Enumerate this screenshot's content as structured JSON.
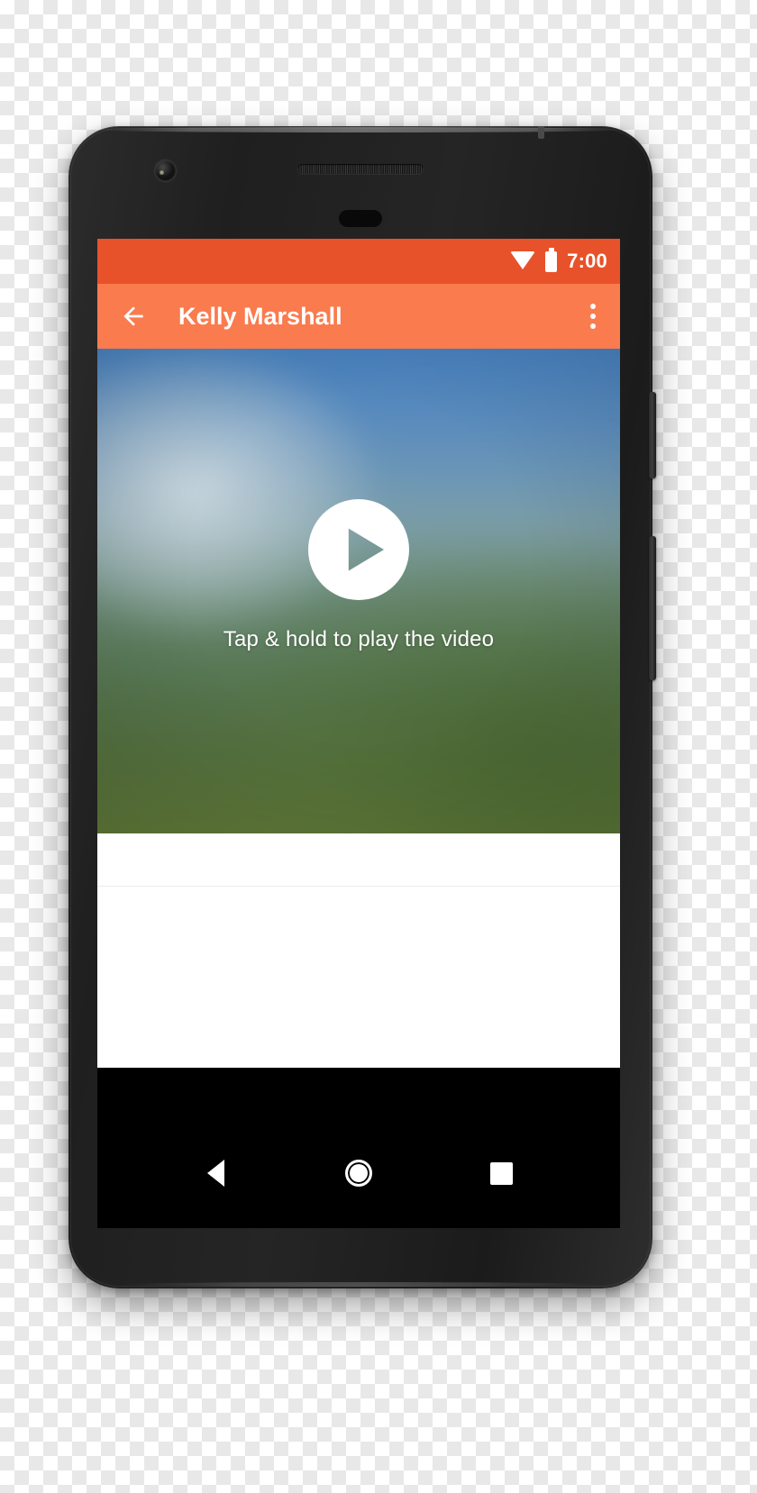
{
  "device": {
    "name": "android-phone-mockup",
    "front_camera_icon": "camera-icon",
    "earpiece_icon": "speaker-grille-icon",
    "sensor_icon": "proximity-sensor-icon",
    "power_button": "power-button",
    "volume_button": "volume-button"
  },
  "status_bar": {
    "background_color": "#E8522A",
    "wifi_icon": "wifi-icon",
    "battery_icon": "battery-full-icon",
    "time": "7:00"
  },
  "app_bar": {
    "background_color": "#FA7B4E",
    "back_icon": "back-arrow-icon",
    "title": "Kelly Marshall",
    "overflow_icon": "more-vert-icon"
  },
  "video": {
    "play_icon": "play-circle-icon",
    "caption": "Tap & hold to play the video",
    "thumbnail_description": "blurred-landscape-sky-and-grass"
  },
  "content": {
    "background_color": "#FFFFFF",
    "divider_color": "#ECECEC"
  },
  "nav_bar": {
    "background_color": "#000000",
    "back_icon": "nav-back-triangle-icon",
    "home_icon": "nav-home-circle-icon",
    "recents_icon": "nav-recents-square-icon"
  }
}
